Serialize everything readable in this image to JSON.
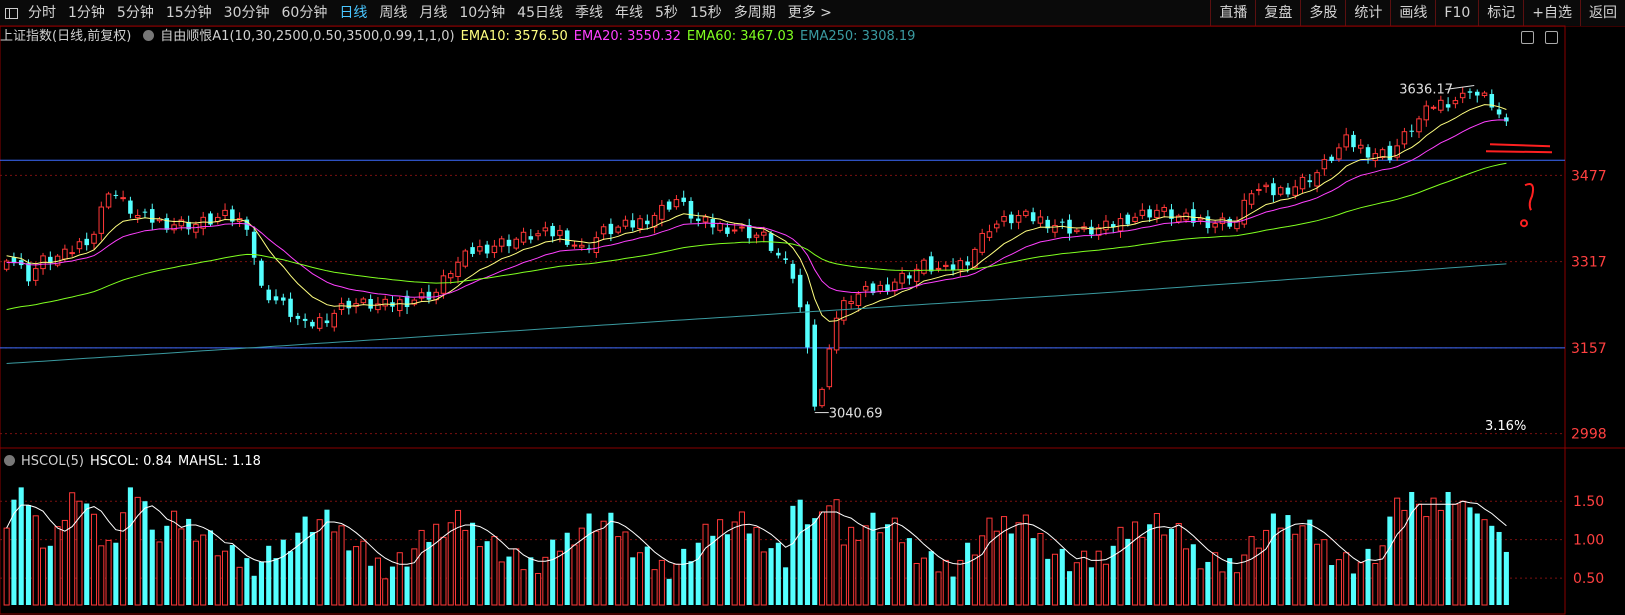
{
  "toolbar": {
    "left_tabs": [
      "分时",
      "1分钟",
      "5分钟",
      "15分钟",
      "30分钟",
      "60分钟",
      "日线",
      "周线",
      "月线",
      "10分钟",
      "45日线",
      "季线",
      "年线",
      "5秒",
      "15秒",
      "多周期",
      "更多 >"
    ],
    "active_tab": "日线",
    "right_tabs": [
      "直播",
      "复盘",
      "多股",
      "统计",
      "画线",
      "F10",
      "标记",
      "+自选",
      "返回"
    ]
  },
  "legend": {
    "title": "上证指数(日线,前复权)",
    "indicator": "自由顺恨A1(10,30,2500,0.50,3500,0.99,1,1,0)",
    "ema10": "EMA10: 3576.50",
    "ema20": "EMA20: 3550.32",
    "ema60": "EMA60: 3467.03",
    "ema250": "EMA250: 3308.19"
  },
  "indicator_legend": {
    "name": "HSCOL(5)",
    "hscol": "HSCOL: 0.84",
    "mahsl": "MAHSL: 1.18"
  },
  "colors": {
    "up": "#ff3838",
    "down": "#54ffff",
    "ema10": "#ffff80",
    "ema20": "#ff40ff",
    "ema60": "#80ff20",
    "ema250": "#3a9aa0",
    "mahsl": "#ffffff",
    "hline": "#3c6cff"
  },
  "chart_data": [
    {
      "type": "candlestick",
      "title": "上证指数(日线,前复权)",
      "ylim": [
        2975,
        3715
      ],
      "y_ticks": [
        3477,
        3317,
        3157,
        2998
      ],
      "horizontal_lines": [
        3505,
        3157
      ],
      "annotations": {
        "high": "3636.17",
        "low": "3040.69",
        "percent": "3.16%"
      },
      "candles": [],
      "series": [
        {
          "name": "EMA10",
          "values": []
        },
        {
          "name": "EMA20",
          "values": []
        },
        {
          "name": "EMA60",
          "values": []
        },
        {
          "name": "EMA250",
          "values": []
        }
      ]
    },
    {
      "type": "bar",
      "title": "HSCOL(5)",
      "ylim": [
        0.15,
        1.88
      ],
      "y_ticks": [
        "1.50",
        "1.00",
        "0.50"
      ],
      "values": [],
      "up_flags": [],
      "series": [
        {
          "name": "MAHSL",
          "values": []
        }
      ]
    }
  ]
}
